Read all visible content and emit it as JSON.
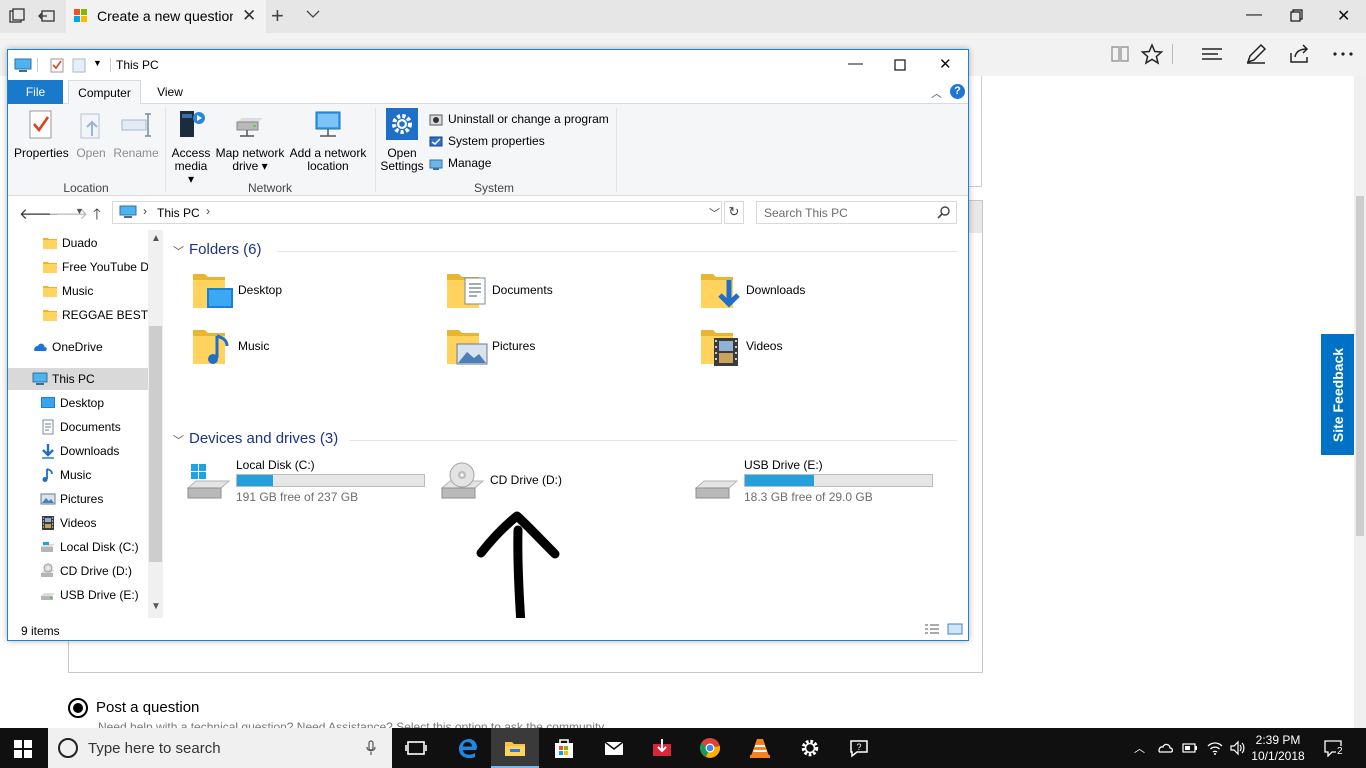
{
  "browser": {
    "tab_title": "Create a new question c",
    "site_feedback": "Site Feedback",
    "page": {
      "post_question_label": "Post a question",
      "post_question_sub": "Need help with a technical question? Need Assistance? Select this option to ask the community"
    }
  },
  "explorer": {
    "window_title": "This PC",
    "ribbon_tabs": [
      "File",
      "Computer",
      "View"
    ],
    "ribbon": {
      "location": {
        "label": "Location",
        "buttons": [
          "Properties",
          "Open",
          "Rename"
        ]
      },
      "network": {
        "label": "Network",
        "access_media": [
          "Access",
          "media ▾"
        ],
        "map_network_drive": [
          "Map network",
          "drive ▾"
        ],
        "add_network_location": [
          "Add a network",
          "location"
        ]
      },
      "system": {
        "label": "System",
        "open_settings": [
          "Open",
          "Settings"
        ],
        "small_items": [
          "Uninstall or change a program",
          "System properties",
          "Manage"
        ]
      }
    },
    "address": {
      "crumb": "This PC"
    },
    "search_placeholder": "Search This PC",
    "sidebar": [
      {
        "label": "Duado",
        "icon": "folder-icon"
      },
      {
        "label": "Free YouTube Do",
        "icon": "folder-icon"
      },
      {
        "label": "Music",
        "icon": "folder-icon"
      },
      {
        "label": "REGGAE BEST",
        "icon": "folder-icon"
      },
      {
        "label": "OneDrive",
        "icon": "onedrive-icon"
      },
      {
        "label": "This PC",
        "icon": "this-pc-icon",
        "selected": true
      },
      {
        "label": "Desktop",
        "icon": "desktop-icon"
      },
      {
        "label": "Documents",
        "icon": "documents-icon"
      },
      {
        "label": "Downloads",
        "icon": "downloads-icon"
      },
      {
        "label": "Music",
        "icon": "music-icon"
      },
      {
        "label": "Pictures",
        "icon": "pictures-icon"
      },
      {
        "label": "Videos",
        "icon": "videos-icon"
      },
      {
        "label": "Local Disk (C:)",
        "icon": "local-disk-icon"
      },
      {
        "label": "CD Drive (D:)",
        "icon": "cd-drive-icon"
      },
      {
        "label": "USB Drive (E:)",
        "icon": "usb-drive-icon"
      }
    ],
    "folders_group": "Folders (6)",
    "folders": [
      "Desktop",
      "Documents",
      "Downloads",
      "Music",
      "Pictures",
      "Videos"
    ],
    "drives_group": "Devices and drives (3)",
    "drives": [
      {
        "name": "Local Disk (C:)",
        "free": "191 GB free of 237 GB",
        "used_fraction": 0.19
      },
      {
        "name": "CD Drive (D:)"
      },
      {
        "name": "USB Drive (E:)",
        "free": "18.3 GB free of 29.0 GB",
        "used_fraction": 0.37
      }
    ],
    "status": "9 items"
  },
  "taskbar": {
    "search_placeholder": "Type here to search",
    "time": "2:39 PM",
    "date": "10/1/2018",
    "notification_count": "2"
  },
  "colors": {
    "accent": "#1979ca",
    "drive_bar": "#26a0da",
    "group_title": "#1e3287",
    "site_feedback": "#0072c6",
    "taskbar": "#101010"
  }
}
